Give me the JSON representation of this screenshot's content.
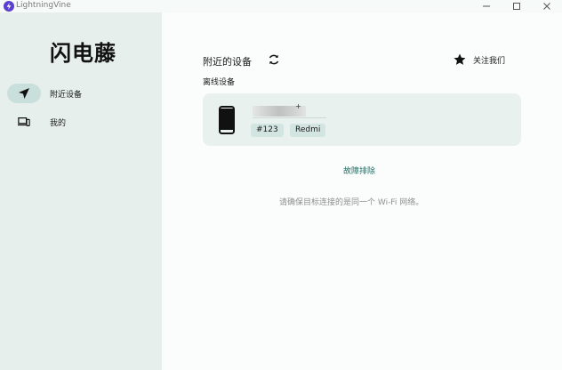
{
  "window": {
    "app_title": "LightningVine",
    "logo_icon": "lightning-icon",
    "controls": [
      "minimize-icon",
      "maximize-icon",
      "close-icon"
    ]
  },
  "sidebar": {
    "brand": "闪电藤",
    "items": [
      {
        "label": "附近设备",
        "icon": "send-icon",
        "active": true
      },
      {
        "label": "我的",
        "icon": "devices-icon",
        "active": false
      }
    ]
  },
  "main": {
    "section_title": "附近的设备",
    "refresh_icon": "refresh-icon",
    "follow_label": "关注我们",
    "follow_icon": "star-icon",
    "offline_label": "离线设备",
    "devices": [
      {
        "icon": "phone-icon",
        "name_mark": "+",
        "id_tag": "#123",
        "brand_tag": "Redmi"
      }
    ],
    "troubleshoot_link": "故障排除",
    "hint": "请确保目标连接的是同一个 Wi-Fi 网络。"
  },
  "colors": {
    "sidebar_bg": "#e6efec",
    "active_pill": "#c9dfdb",
    "card_bg": "#e9f1ef",
    "chip_bg": "#d3e5e1",
    "link": "#1a6f66",
    "logo": "#5b3fd0"
  }
}
